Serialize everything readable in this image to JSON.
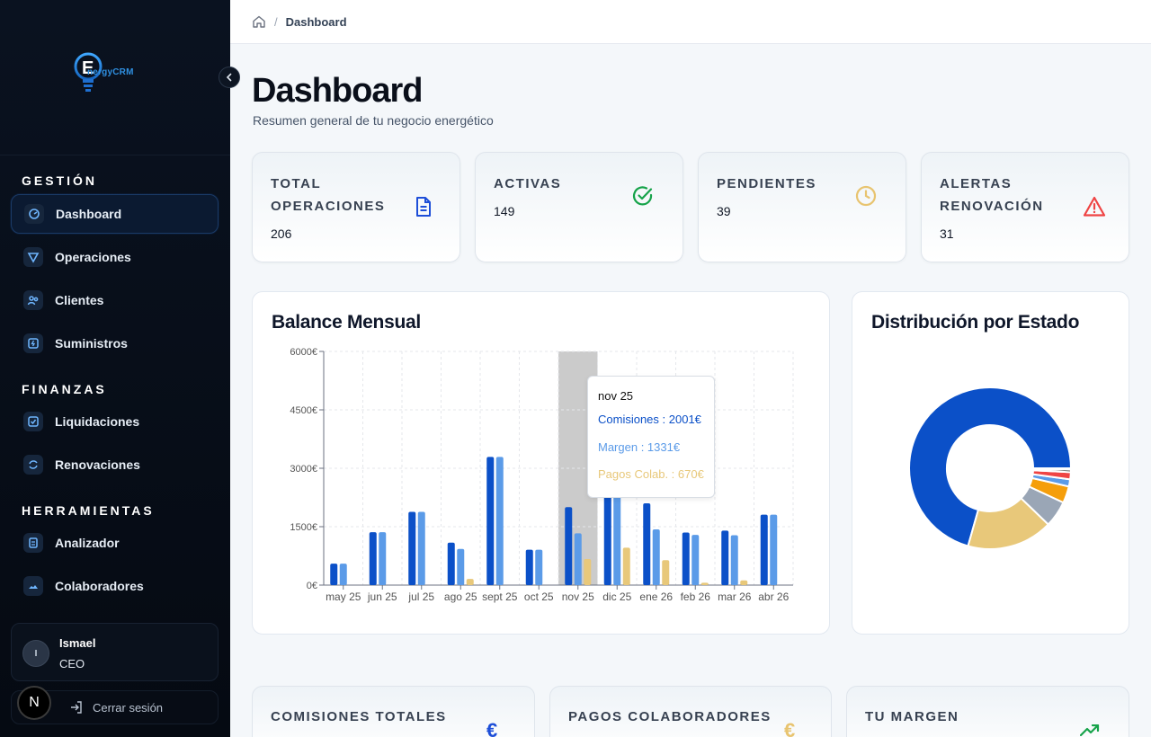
{
  "brand": {
    "logo_letter": "E",
    "logo_text": "nergyCRM"
  },
  "breadcrumb": {
    "current": "Dashboard",
    "separator": "/"
  },
  "page": {
    "title": "Dashboard",
    "subtitle": "Resumen general de tu negocio energético"
  },
  "sidebar": {
    "sections": [
      {
        "label": "GESTIÓN",
        "items": [
          {
            "label": "Dashboard",
            "icon": "dashboard-icon",
            "active": true
          },
          {
            "label": "Operaciones",
            "icon": "operations-icon"
          },
          {
            "label": "Clientes",
            "icon": "clients-icon"
          },
          {
            "label": "Suministros",
            "icon": "supply-icon"
          }
        ]
      },
      {
        "label": "FINANZAS",
        "items": [
          {
            "label": "Liquidaciones",
            "icon": "settlements-icon"
          },
          {
            "label": "Renovaciones",
            "icon": "renewals-icon"
          }
        ]
      },
      {
        "label": "HERRAMIENTAS",
        "items": [
          {
            "label": "Analizador",
            "icon": "analyzer-icon"
          },
          {
            "label": "Colaboradores",
            "icon": "collaborators-icon"
          }
        ]
      }
    ],
    "user": {
      "initial": "I",
      "name": "Ismael",
      "role": "CEO"
    },
    "logout_label": "Cerrar sesión",
    "badge": "N"
  },
  "stats": [
    {
      "label": "TOTAL OPERACIONES",
      "value": "206",
      "icon": "document-icon",
      "color": "#1d4ed8"
    },
    {
      "label": "ACTIVAS",
      "value": "149",
      "icon": "check-circle-icon",
      "color": "#16a34a"
    },
    {
      "label": "PENDIENTES",
      "value": "39",
      "icon": "clock-icon",
      "color": "#e8c470"
    },
    {
      "label": "ALERTAS RENOVACIÓN",
      "value": "31",
      "icon": "warning-icon",
      "color": "#ef4444"
    }
  ],
  "panels": {
    "balance_title": "Balance Mensual",
    "distribution_title": "Distribución por Estado"
  },
  "tooltip": {
    "title": "nov 25",
    "rows": [
      {
        "label": "Comisiones : 2001€",
        "color": "#0b50c8"
      },
      {
        "label": "Margen : 1331€",
        "color": "#5b9be8"
      },
      {
        "label": "Pagos Colab. : 670€",
        "color": "#e8c87a"
      }
    ]
  },
  "bottom_cards": [
    {
      "label": "COMISIONES TOTALES",
      "icon": "euro-icon",
      "color": "#1d4ed8"
    },
    {
      "label": "PAGOS COLABORADORES",
      "icon": "euro-icon",
      "color": "#e8c470"
    },
    {
      "label": "TU MARGEN",
      "icon": "trend-up-icon",
      "color": "#16a34a"
    }
  ],
  "chart_data": [
    {
      "type": "bar",
      "categories": [
        "may 25",
        "jun 25",
        "jul 25",
        "ago 25",
        "sept 25",
        "oct 25",
        "nov 25",
        "dic 25",
        "ene 26",
        "feb 26",
        "mar 26",
        "abr 26"
      ],
      "series": [
        {
          "name": "Comisiones",
          "color": "#0b50c8",
          "values": [
            550,
            1360,
            1880,
            1090,
            3290,
            910,
            2001,
            2550,
            2100,
            1350,
            1400,
            1810
          ]
        },
        {
          "name": "Margen",
          "color": "#5b9be8",
          "values": [
            550,
            1360,
            1880,
            930,
            3290,
            910,
            1331,
            2300,
            1430,
            1290,
            1280,
            1810
          ]
        },
        {
          "name": "Pagos Colab.",
          "color": "#e8c87a",
          "values": [
            0,
            0,
            0,
            160,
            0,
            0,
            670,
            960,
            640,
            60,
            120,
            0
          ]
        }
      ],
      "yticks": [
        "0€",
        "1500€",
        "3000€",
        "4500€",
        "6000€"
      ],
      "ylim": [
        0,
        6000
      ],
      "highlight_index": 6,
      "grid": true
    },
    {
      "type": "pie",
      "donut": true,
      "slices": [
        {
          "value": 148,
          "color": "#0b50c8"
        },
        {
          "value": 36,
          "color": "#e8c87a"
        },
        {
          "value": 11,
          "color": "#9aa6b6"
        },
        {
          "value": 7,
          "color": "#f59e0b"
        },
        {
          "value": 3,
          "color": "#5b9be8"
        },
        {
          "value": 3,
          "color": "#ef4444"
        },
        {
          "value": 1,
          "color": "#0a0a0a"
        },
        {
          "value": 0.6,
          "color": "#cbd5e1"
        }
      ]
    }
  ]
}
